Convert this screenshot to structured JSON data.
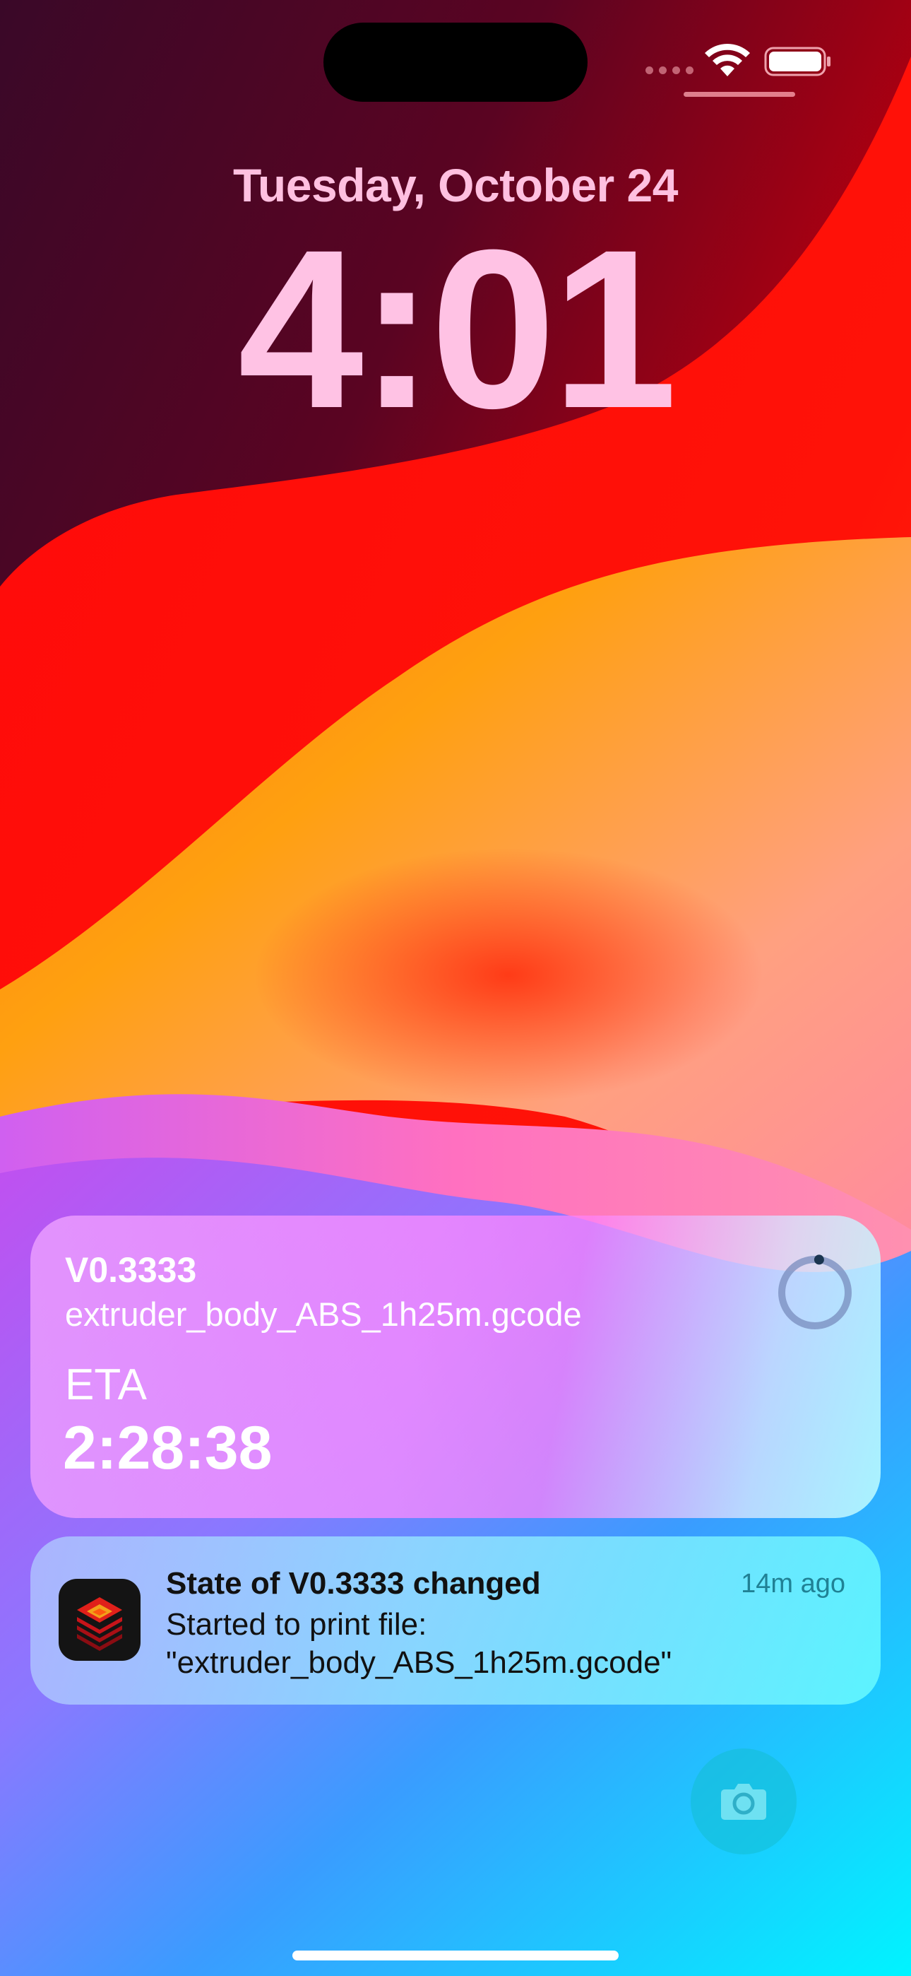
{
  "lock_screen": {
    "date": "Tuesday, October 24",
    "time": "4:01"
  },
  "status_bar": {
    "wifi_icon": "wifi-icon",
    "battery_icon": "battery-icon",
    "battery_level": 1.0
  },
  "live_activity": {
    "printer_name": "V0.3333",
    "file_name": "extruder_body_ABS_1h25m.gcode",
    "eta_label": "ETA",
    "eta_value": "2:28:38",
    "progress": 0.02
  },
  "notification": {
    "title": "State of V0.3333 changed",
    "time": "14m ago",
    "body_line1": "Started to print file:",
    "body_line2": "\"extruder_body_ABS_1h25m.gcode\"",
    "app_icon": "printer-layers-icon"
  },
  "camera": {
    "icon": "camera-icon"
  },
  "colors": {
    "time_text": "#ffc2e4",
    "wallpaper_red": "#ff1a10",
    "wallpaper_orange": "#ff9a1a",
    "wallpaper_cyan": "#10e8ff"
  }
}
